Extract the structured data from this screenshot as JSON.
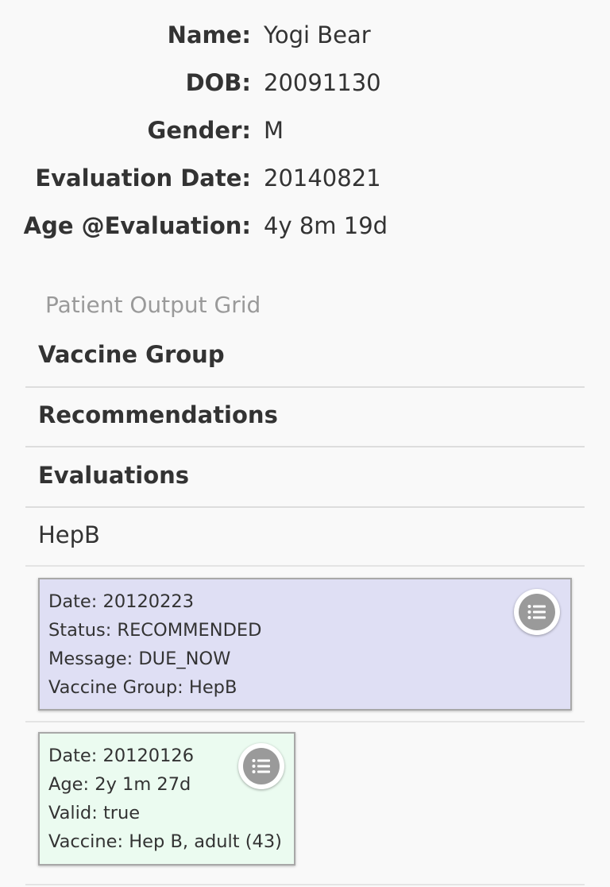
{
  "patient": {
    "name_label": "Name:",
    "name_value": "Yogi Bear",
    "dob_label": "DOB:",
    "dob_value": "20091130",
    "gender_label": "Gender:",
    "gender_value": "M",
    "eval_date_label": "Evaluation Date:",
    "eval_date_value": "20140821",
    "age_label": "Age @Evaluation:",
    "age_value": "4y 8m 19d"
  },
  "grid": {
    "title": "Patient Output Grid",
    "sections": {
      "vaccine_group": "Vaccine Group",
      "recommendations": "Recommendations",
      "evaluations": "Evaluations",
      "group_row": "HepB"
    }
  },
  "recommendation_card": {
    "date": "Date: 20120223",
    "status": "Status: RECOMMENDED",
    "message": "Message: DUE_NOW",
    "vaccine_group": "Vaccine Group: HepB",
    "menu_icon": "list-icon",
    "bg_color": "#dfdff4"
  },
  "evaluation_card": {
    "date": "Date: 20120126",
    "age": "Age: 2y 1m 27d",
    "valid": "Valid: true",
    "vaccine": "Vaccine: Hep B, adult (43)",
    "menu_icon": "list-icon",
    "bg_color": "#ebfbf0"
  }
}
